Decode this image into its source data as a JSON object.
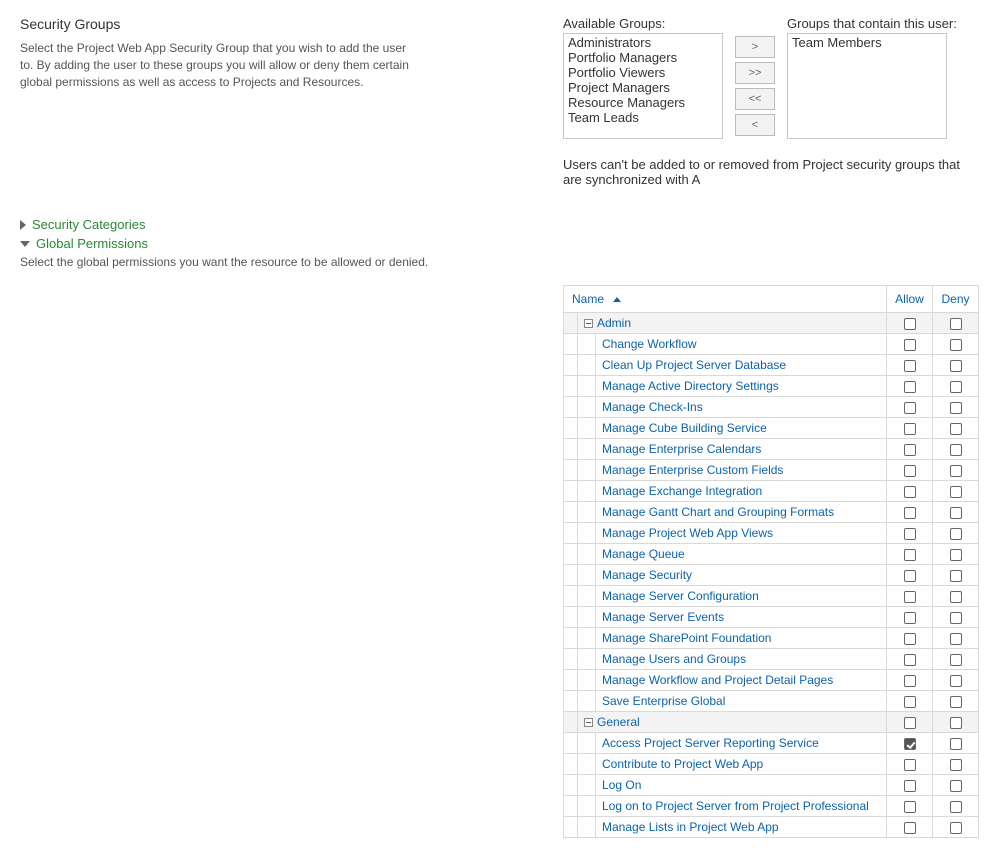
{
  "security_groups": {
    "title": "Security Groups",
    "desc": "Select the Project Web App Security Group that you wish to add the user to. By adding the user to these groups you will allow or deny them certain global permissions as well as access to Projects and Resources.",
    "available_label": "Available Groups:",
    "available": [
      "Administrators",
      "Portfolio Managers",
      "Portfolio Viewers",
      "Project Managers",
      "Resource Managers",
      "Team Leads"
    ],
    "contain_label": "Groups that contain this user:",
    "contain": [
      "Team Members"
    ],
    "buttons": {
      "add": ">",
      "addall": ">>",
      "removeall": "<<",
      "remove": "<"
    },
    "note": "Users can't be added to or removed from Project security groups that are synchronized with A"
  },
  "sections": {
    "categories": "Security Categories",
    "global": "Global Permissions",
    "global_help": "Select the global permissions you want the resource to be allowed or denied."
  },
  "table": {
    "headers": {
      "name": "Name",
      "allow": "Allow",
      "deny": "Deny"
    },
    "groups": [
      {
        "name": "Admin",
        "rows": [
          {
            "n": "Change Workflow",
            "a": false,
            "d": false
          },
          {
            "n": "Clean Up Project Server Database",
            "a": false,
            "d": false
          },
          {
            "n": "Manage Active Directory Settings",
            "a": false,
            "d": false
          },
          {
            "n": "Manage Check-Ins",
            "a": false,
            "d": false
          },
          {
            "n": "Manage Cube Building Service",
            "a": false,
            "d": false
          },
          {
            "n": "Manage Enterprise Calendars",
            "a": false,
            "d": false
          },
          {
            "n": "Manage Enterprise Custom Fields",
            "a": false,
            "d": false
          },
          {
            "n": "Manage Exchange Integration",
            "a": false,
            "d": false
          },
          {
            "n": "Manage Gantt Chart and Grouping Formats",
            "a": false,
            "d": false
          },
          {
            "n": "Manage Project Web App Views",
            "a": false,
            "d": false
          },
          {
            "n": "Manage Queue",
            "a": false,
            "d": false
          },
          {
            "n": "Manage Security",
            "a": false,
            "d": false
          },
          {
            "n": "Manage Server Configuration",
            "a": false,
            "d": false
          },
          {
            "n": "Manage Server Events",
            "a": false,
            "d": false
          },
          {
            "n": "Manage SharePoint Foundation",
            "a": false,
            "d": false
          },
          {
            "n": "Manage Users and Groups",
            "a": false,
            "d": false
          },
          {
            "n": "Manage Workflow and Project Detail Pages",
            "a": false,
            "d": false
          },
          {
            "n": "Save Enterprise Global",
            "a": false,
            "d": false
          }
        ]
      },
      {
        "name": "General",
        "rows": [
          {
            "n": "Access Project Server Reporting Service",
            "a": true,
            "d": false
          },
          {
            "n": "Contribute to Project Web App",
            "a": false,
            "d": false
          },
          {
            "n": "Log On",
            "a": false,
            "d": false
          },
          {
            "n": "Log on to Project Server from Project Professional",
            "a": false,
            "d": false
          },
          {
            "n": "Manage Lists in Project Web App",
            "a": false,
            "d": false
          }
        ]
      }
    ]
  }
}
